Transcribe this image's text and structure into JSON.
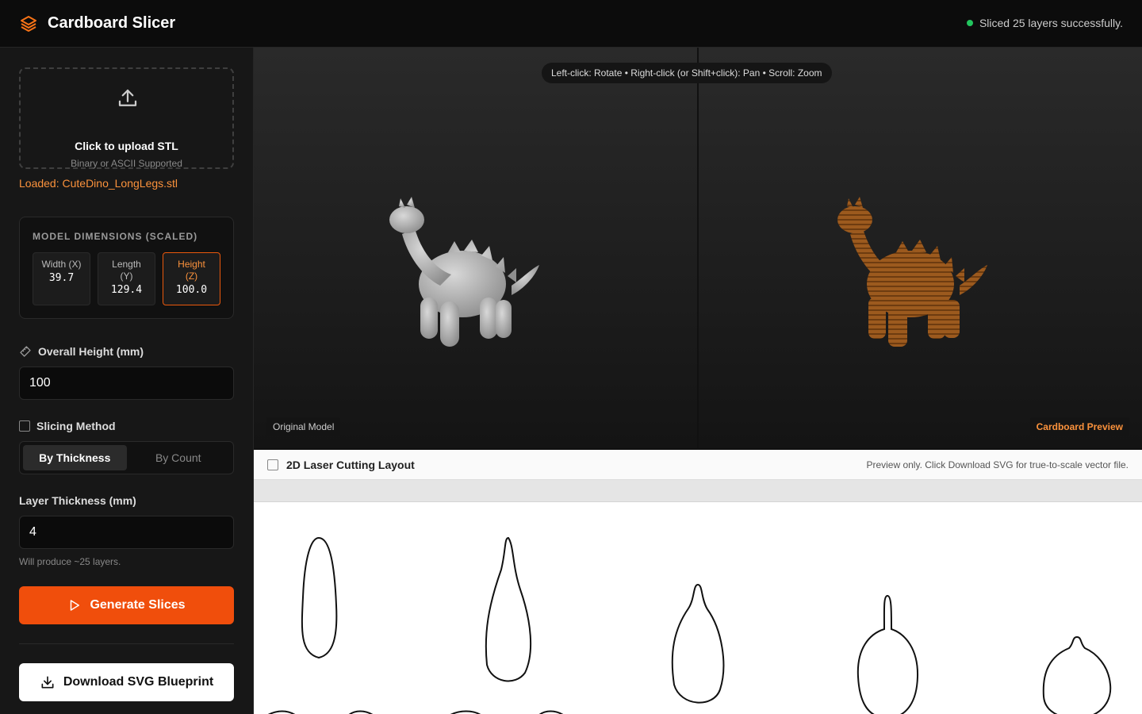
{
  "app": {
    "title": "Cardboard Slicer",
    "status": "Sliced 25 layers successfully."
  },
  "upload": {
    "title": "Click to upload STL",
    "subtitle": "Binary or ASCII Supported",
    "loaded": "Loaded: CuteDino_LongLegs.stl"
  },
  "dimensions": {
    "title": "MODEL DIMENSIONS (SCALED)",
    "items": [
      {
        "label": "Width (X)",
        "value": "39.7"
      },
      {
        "label": "Length (Y)",
        "value": "129.4"
      },
      {
        "label": "Height (Z)",
        "value": "100.0"
      }
    ]
  },
  "overall_height": {
    "label": "Overall Height (mm)",
    "value": "100"
  },
  "slicing": {
    "label": "Slicing Method",
    "options": [
      "By Thickness",
      "By Count"
    ],
    "selected": "By Thickness"
  },
  "thickness": {
    "label": "Layer Thickness (mm)",
    "value": "4",
    "hint": "Will produce ~25 layers."
  },
  "buttons": {
    "generate": "Generate Slices",
    "download": "Download SVG Blueprint"
  },
  "viewer": {
    "help": "Left-click: Rotate • Right-click (or Shift+click): Pan • Scroll: Zoom",
    "left_tag": "Original Model",
    "right_tag": "Cardboard Preview"
  },
  "layout": {
    "title": "2D Laser Cutting Layout",
    "note": "Preview only. Click Download SVG for true-to-scale vector file."
  },
  "colors": {
    "accent": "#f04e0c",
    "accent_text": "#fb923c",
    "status_ok": "#22c55e"
  }
}
